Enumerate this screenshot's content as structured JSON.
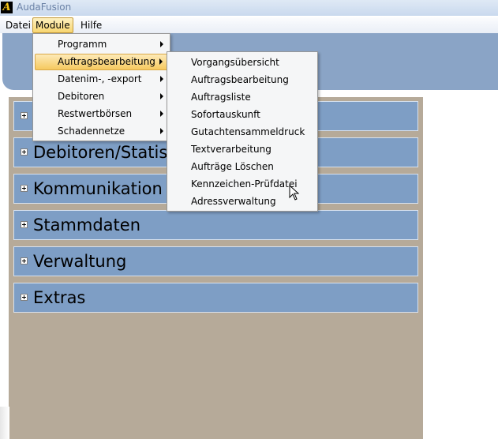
{
  "window": {
    "title": "AudaFusion",
    "logo_letter": "A"
  },
  "menubar": {
    "items": [
      {
        "label": "Datei"
      },
      {
        "label": "Module"
      },
      {
        "label": "Hilfe"
      }
    ]
  },
  "sections": [
    {
      "label": ""
    },
    {
      "label": "Debitoren/Statist"
    },
    {
      "label": "Kommunikation"
    },
    {
      "label": "Stammdaten"
    },
    {
      "label": "Verwaltung"
    },
    {
      "label": "Extras"
    }
  ],
  "module_menu": {
    "items": [
      {
        "label": "Programm",
        "has_submenu": true
      },
      {
        "label": "Auftragsbearbeitung",
        "has_submenu": true,
        "highlighted": true
      },
      {
        "label": "Datenim-, -export",
        "has_submenu": true
      },
      {
        "label": "Debitoren",
        "has_submenu": true
      },
      {
        "label": "Restwertbörsen",
        "has_submenu": true
      },
      {
        "label": "Schadennetze",
        "has_submenu": true
      }
    ]
  },
  "auftrags_submenu": {
    "items": [
      {
        "label": "Vorgangsübersicht"
      },
      {
        "label": "Auftragsbearbeitung"
      },
      {
        "label": "Auftragsliste"
      },
      {
        "label": "Sofortauskunft"
      },
      {
        "label": "Gutachtensammeldruck"
      },
      {
        "label": "Textverarbeitung"
      },
      {
        "label": "Aufträge Löschen"
      },
      {
        "label": "Kennzeichen-Prüfdatei"
      },
      {
        "label": "Adressverwaltung"
      }
    ]
  },
  "colors": {
    "section_bar": "#7e9ec5",
    "content_panel": "#b6aa99",
    "banner": "#8aa4c6",
    "menu_highlight": "#f6c95f"
  }
}
